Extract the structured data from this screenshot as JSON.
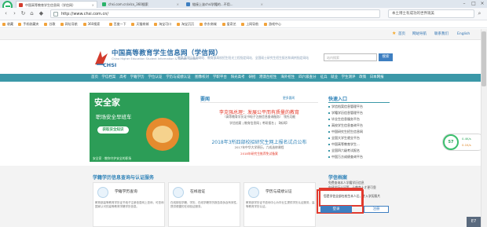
{
  "browser": {
    "tabs": [
      {
        "label": "中国高等教育学生信息网（学信网）"
      },
      {
        "label": "chsi.com.cn/xlcx_360搜索"
      },
      {
        "label": "链接上该chsi学籍的...不用..."
      }
    ],
    "address": "http://www.chsi.com.cn/",
    "search_text": "本土博士有成功的世界观美",
    "bookmarks": [
      "收藏",
      "手机收藏夹",
      "谷歌",
      "网址导航",
      "360搜索",
      "百度一下",
      "天猫商城",
      "淘宝可口",
      "淘宝沉沉",
      "京东商城",
      "爱奇艺",
      "上网导航",
      "游戏中心"
    ],
    "icon_names": [
      "back-icon",
      "forward-icon",
      "refresh-icon",
      "home-icon",
      "lock-icon",
      "search-icon"
    ],
    "brand_color": "#2bb36a"
  },
  "page": {
    "topbar_links": [
      "首页",
      "网站导航",
      "联系我们",
      "English"
    ],
    "title": "中国高等教育学生信息网（学信网）",
    "subtitle": "China Higher Education Student Information & Career Center",
    "logo_text": "CHSI",
    "slogan": "教育部学历查询网站、教育部高校招生阳光工程指定网站、全国硕士研究生招生报名和调剂指定网站",
    "search_placeholder": "站内搜索",
    "search_button": "搜索",
    "nav": [
      "首页",
      "学信档案",
      "高考",
      "学籍学历",
      "学位认证",
      "学历与成绩认证",
      "图像校对",
      "学职平台",
      "阳光高考",
      "研招",
      "港澳台招生",
      "海外招生",
      "四六级查分",
      "征兵",
      "就业",
      "学生测评",
      "政策",
      "日本网报"
    ],
    "nav_color": "#3b98a8",
    "banner": {
      "title": "安全家",
      "subtitle": "职场安全早班车",
      "button": "获取安全知识",
      "tip": "安全家 · 教你守护安全的职场"
    },
    "news": {
      "heading": "要闻",
      "more": "更多要闻",
      "items": [
        "李克强总理：发展公平而有质量的教育",
        "（高等教育学历证书电子注册信息查询服务） 领先功能",
        "学信档案 | 教育信息网 | 考研报名 | 【新闻】",
        "2018年3所四部校招研究生网上报名试点公布",
        "2017年中华大学原历，六成选修课程",
        "2018年研究生推荐免试备案"
      ]
    },
    "quick": {
      "heading": "快速入口",
      "items": [
        "学信档案信息管理平台",
        "学籍学历信息管理平台",
        "毕业生信息服务平台",
        "高校学生信息查询平台",
        "中国研究生招生信息网",
        "全国大学生就业平台",
        "中国高等教育学生...",
        "全国四六级考试报名",
        "中国万方成绩查询平台"
      ]
    },
    "services": {
      "heading": "学籍学历信息查询与认证服务",
      "cards": [
        {
          "title": "学籍学历查询",
          "desc": "教育部高等教育学历证书电子注册信息网上查询，可查询国家认可的高等教育学籍学历信息。"
        },
        {
          "title": "在线验证",
          "desc": "在线核验学籍、学历、在线学籍学历报告真伪及有效性，提供便捷的在线验证服务。"
        },
        {
          "title": "学历与成绩认证",
          "desc": "教育部学历证书查询中心为毕业生提供学历认证服务，高等教育学历认证。"
        }
      ]
    },
    "account": {
      "heading": "学信档案",
      "lines": [
        "免费查询本人学籍学历信息",
        "申请学历认证等，让教育人才更可靠"
      ],
      "highlight_text": "您是学信全部在校生本人后，才入学历照片",
      "login": "登录",
      "register": "注册"
    },
    "widget": {
      "percent": "57",
      "speed_up": "0.4K/s",
      "speed_down": "0.1K/s"
    },
    "floating_button": "E7"
  }
}
